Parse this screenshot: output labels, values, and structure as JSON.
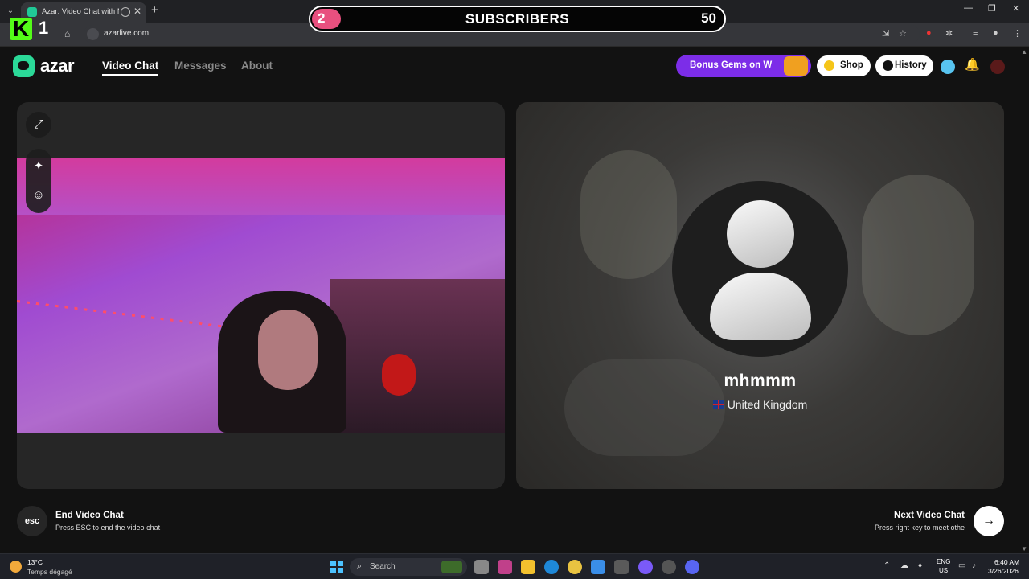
{
  "browser": {
    "tab_title": "Azar: Video Chat with New",
    "url": "azarlive.com"
  },
  "overlay": {
    "kick_count": "1",
    "subscriber_current": "2",
    "subscriber_label": "SUBSCRIBERS",
    "subscriber_goal": "50",
    "subscriber_progress": 0.04
  },
  "header": {
    "brand": "azar",
    "nav": [
      "Video Chat",
      "Messages",
      "About"
    ],
    "bonus_gems": "Bonus Gems on W",
    "shop": "Shop",
    "history": "History"
  },
  "peer": {
    "name": "mhmmm",
    "country": "United Kingdom"
  },
  "controls": {
    "esc_key": "esc",
    "end_title": "End Video Chat",
    "end_sub": "Press ESC to end the video chat",
    "next_title": "Next Video Chat",
    "next_sub": "Press right key to meet othe"
  },
  "taskbar": {
    "temp": "13°C",
    "weather": "Temps dégagé",
    "search": "Search",
    "lang_line1": "ENG",
    "lang_line2": "US",
    "time": "6:40 AM",
    "date": "3/26/2026"
  },
  "colors": {
    "accent_purple": "#7c2de8",
    "brand_green": "#2bd998",
    "progress_pink": "#e8507f"
  }
}
